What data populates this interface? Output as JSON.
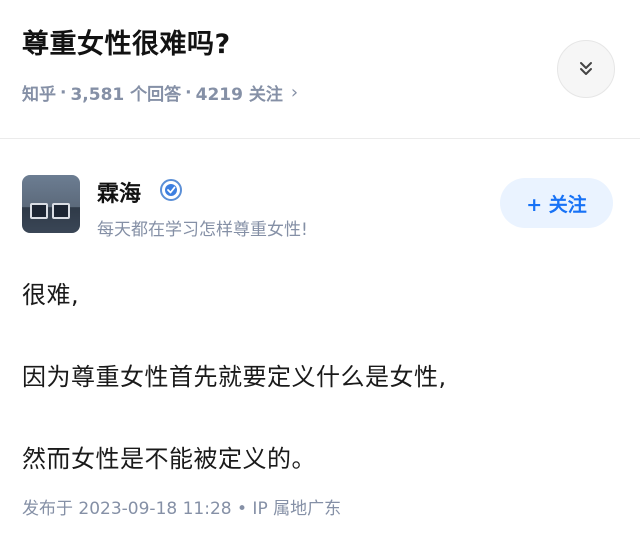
{
  "question": {
    "title": "尊重女性很难吗?",
    "source": "知乎",
    "answers": "3,581 个回答",
    "followers": "4219 关注",
    "separator": "·",
    "chevron": "›"
  },
  "icons": {
    "expand": "chevrons-down-icon",
    "badge": "verified-badge-icon"
  },
  "author": {
    "name": "霖海",
    "bio": "每天都在学习怎样尊重女性!",
    "follow_label": "+ 关注"
  },
  "answer": {
    "paragraphs": [
      "很难,",
      "因为尊重女性首先就要定义什么是女性,",
      "然而女性是不能被定义的。"
    ],
    "meta": "发布于 2023-09-18 11:28 • IP 属地广东"
  },
  "colors": {
    "accent": "#1772f6",
    "follow_bg": "#eaf3ff",
    "meta_gray": "#8590a6"
  }
}
